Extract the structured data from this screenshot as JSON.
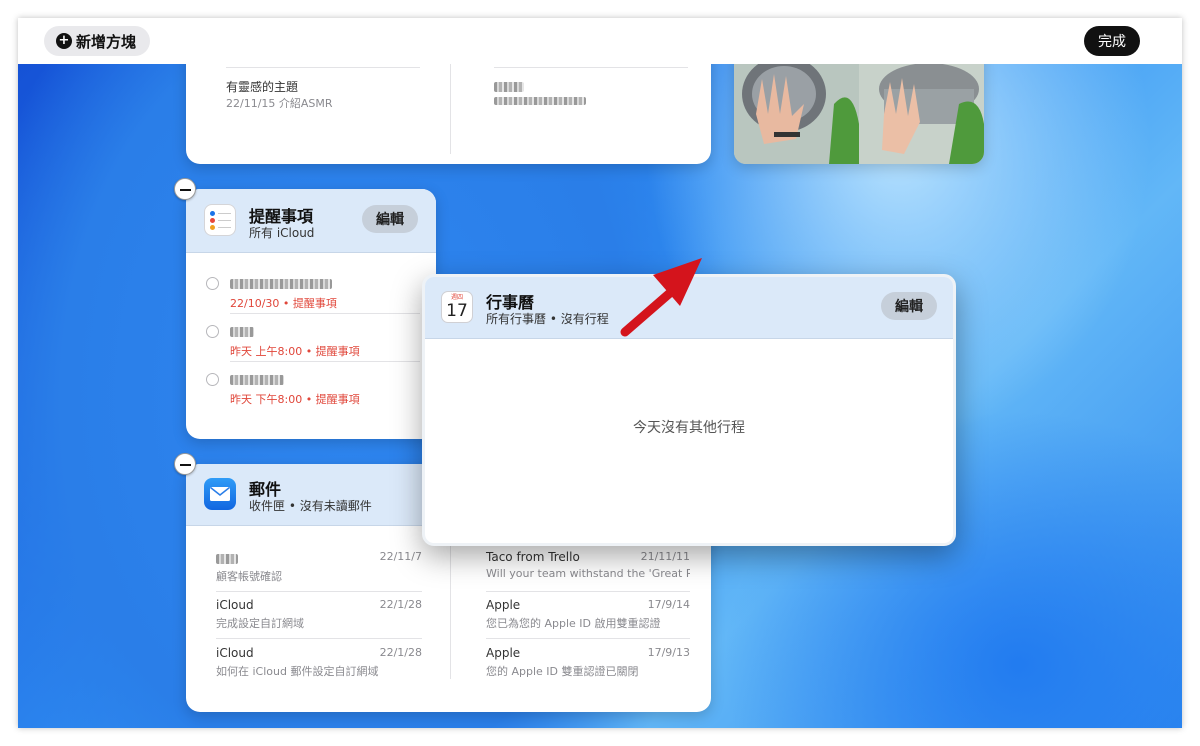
{
  "toolbar": {
    "add_block_label": "新增方塊",
    "done_label": "完成"
  },
  "notes_widget": {
    "left_title": "有靈感的主題",
    "left_meta": "22/11/15 介紹ASMR"
  },
  "reminders_widget": {
    "title": "提醒事項",
    "subtitle": "所有 iCloud",
    "edit_label": "編輯",
    "items": [
      {
        "meta": "22/10/30 • 提醒事項"
      },
      {
        "meta": "昨天 上午8:00 • 提醒事項"
      },
      {
        "meta": "昨天 下午8:00 • 提醒事項"
      }
    ]
  },
  "calendar_widget": {
    "title": "行事曆",
    "subtitle": "所有行事曆 • 沒有行程",
    "edit_label": "編輯",
    "icon_weekday": "週四",
    "icon_day": "17",
    "empty_message": "今天沒有其他行程"
  },
  "mail_widget": {
    "title": "郵件",
    "subtitle": "收件匣 • 沒有未讀郵件",
    "left": [
      {
        "sender": "",
        "preview": "顧客帳號確認",
        "date": "22/11/7"
      },
      {
        "sender": "iCloud",
        "preview": "完成設定自訂網域",
        "date": "22/1/28"
      },
      {
        "sender": "iCloud",
        "preview": "如何在 iCloud 郵件設定自訂網域",
        "date": "22/1/28"
      }
    ],
    "right": [
      {
        "sender": "Taco from Trello",
        "preview": "Will your team withstand the 'Great Resig...",
        "date": "21/11/11"
      },
      {
        "sender": "Apple",
        "preview": "您已為您的 Apple ID 啟用雙重認證",
        "date": "17/9/14"
      },
      {
        "sender": "Apple",
        "preview": "您的 Apple ID 雙重認證已關閉",
        "date": "17/9/13"
      }
    ]
  },
  "colors": {
    "accent_bg": "#dbe9f9",
    "arrow": "#d4141c",
    "desktop": "#2a7ee8"
  }
}
